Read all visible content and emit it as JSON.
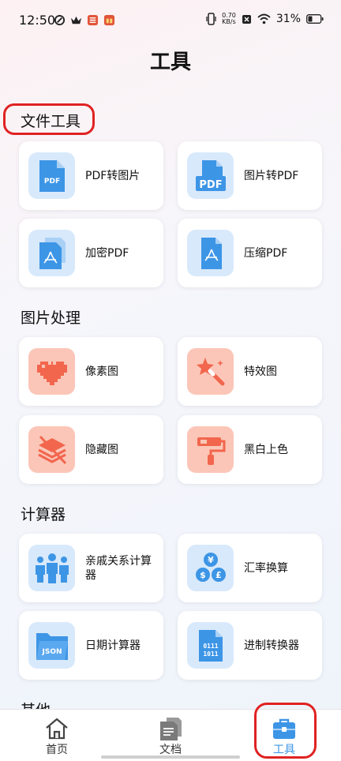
{
  "status": {
    "time": "12:50",
    "net_speed_value": "0.70",
    "net_speed_unit": "KB/s",
    "battery": "31%"
  },
  "title": "工具",
  "sections": [
    {
      "title": "文件工具"
    },
    {
      "title": "图片处理"
    },
    {
      "title": "计算器"
    },
    {
      "title": "其他"
    }
  ],
  "tools": [
    {
      "label": "PDF转图片",
      "icon": "pdf-document-icon",
      "icon_text": "PDF"
    },
    {
      "label": "图片转PDF",
      "icon": "image-to-pdf-icon",
      "icon_text": "PDF"
    },
    {
      "label": "加密PDF",
      "icon": "encrypted-pdf-icon"
    },
    {
      "label": "压缩PDF",
      "icon": "compress-pdf-icon"
    },
    {
      "label": "像素图",
      "icon": "pixel-heart-icon"
    },
    {
      "label": "特效图",
      "icon": "magic-wand-icon"
    },
    {
      "label": "隐藏图",
      "icon": "hidden-layers-icon"
    },
    {
      "label": "黑白上色",
      "icon": "paint-roller-icon"
    },
    {
      "label": "亲戚关系计算器",
      "icon": "family-icon"
    },
    {
      "label": "汇率换算",
      "icon": "currency-exchange-icon",
      "icon_symbols": [
        "¥",
        "$",
        "£"
      ]
    },
    {
      "label": "日期计算器",
      "icon": "json-folder-icon",
      "icon_text": "JSON"
    },
    {
      "label": "进制转换器",
      "icon": "binary-file-icon",
      "icon_lines": [
        "0111",
        "1011"
      ]
    }
  ],
  "nav": [
    {
      "label": "首页",
      "icon": "home-icon"
    },
    {
      "label": "文档",
      "icon": "document-icon"
    },
    {
      "label": "工具",
      "icon": "toolbox-icon",
      "active": true
    }
  ],
  "colors": {
    "accent_blue": "#3d95e6",
    "icon_bg_blue": "#d8e9fb",
    "icon_bg_pink": "#fbc6b8",
    "icon_pink": "#f2664d",
    "highlight_red": "#e02222"
  }
}
